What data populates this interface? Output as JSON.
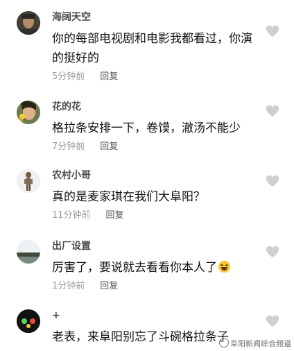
{
  "comments": [
    {
      "username": "海阔天空",
      "text": "你的每部电视剧和电影我都看过，你演的挺好的",
      "time": "5分钟前",
      "reply": "回复",
      "avatar": "man-avatar"
    },
    {
      "username": "花的花",
      "text": "格拉条安排一下，卷馍，澈汤不能少",
      "time": "7分钟前",
      "reply": "回复",
      "avatar": "woman-flower-avatar"
    },
    {
      "username": "农村小哥",
      "text": "真的是麦家琪在我们大阜阳？",
      "time": "11分钟前",
      "reply": "回复",
      "avatar": "figurine-avatar"
    },
    {
      "username": "出厂设置",
      "text": "厉害了，要说就去看看你本人了",
      "time": "1分钟前",
      "reply": "回复",
      "avatar": "landscape-avatar",
      "emoji": "laughing-tears-emoji"
    },
    {
      "username": "+",
      "text": "老表，来阜阳别忘了斗碗格拉条子",
      "time": "",
      "reply": "",
      "avatar": "dots-avatar"
    }
  ],
  "watermark": "阜阳新闻综合频道",
  "colors": {
    "username": "#4d4d4d",
    "text": "#111111",
    "meta": "#9a9a9a",
    "like_icon": "#c8c8c8"
  }
}
